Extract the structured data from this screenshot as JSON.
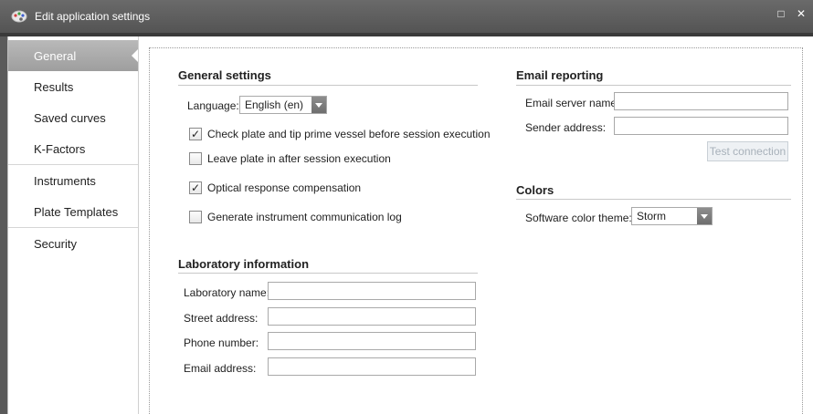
{
  "window": {
    "title": "Edit application settings",
    "app_icon": "palette-icon",
    "controls": {
      "restore": "□",
      "close": "✕"
    }
  },
  "sidebar": {
    "items": [
      {
        "label": "General",
        "active": true
      },
      {
        "label": "Results"
      },
      {
        "label": "Saved curves"
      },
      {
        "label": "K-Factors"
      },
      {
        "label": "Instruments"
      },
      {
        "label": "Plate Templates"
      },
      {
        "label": "Security"
      }
    ]
  },
  "general_settings": {
    "title": "General settings",
    "language_label": "Language:",
    "language_value": "English (en)",
    "options": [
      {
        "label": "Check plate and tip prime vessel before session execution",
        "checked": true
      },
      {
        "label": "Leave plate in after session execution",
        "checked": false
      },
      {
        "label": "Optical response compensation",
        "checked": true
      },
      {
        "label": "Generate instrument communication log",
        "checked": false
      }
    ]
  },
  "laboratory_information": {
    "title": "Laboratory information",
    "fields": [
      {
        "label": "Laboratory name:",
        "value": ""
      },
      {
        "label": "Street address:",
        "value": ""
      },
      {
        "label": "Phone number:",
        "value": ""
      },
      {
        "label": "Email address:",
        "value": ""
      }
    ]
  },
  "email_reporting": {
    "title": "Email reporting",
    "server_label": "Email server name:",
    "server_value": "",
    "sender_label": "Sender address:",
    "sender_value": "",
    "test_button": "Test connection"
  },
  "colors": {
    "title": "Colors",
    "theme_label": "Software color theme:",
    "theme_value": "Storm"
  },
  "style": {
    "titlebar_color": "#5e5e5e",
    "active_item_color": "#a8a8a8"
  }
}
